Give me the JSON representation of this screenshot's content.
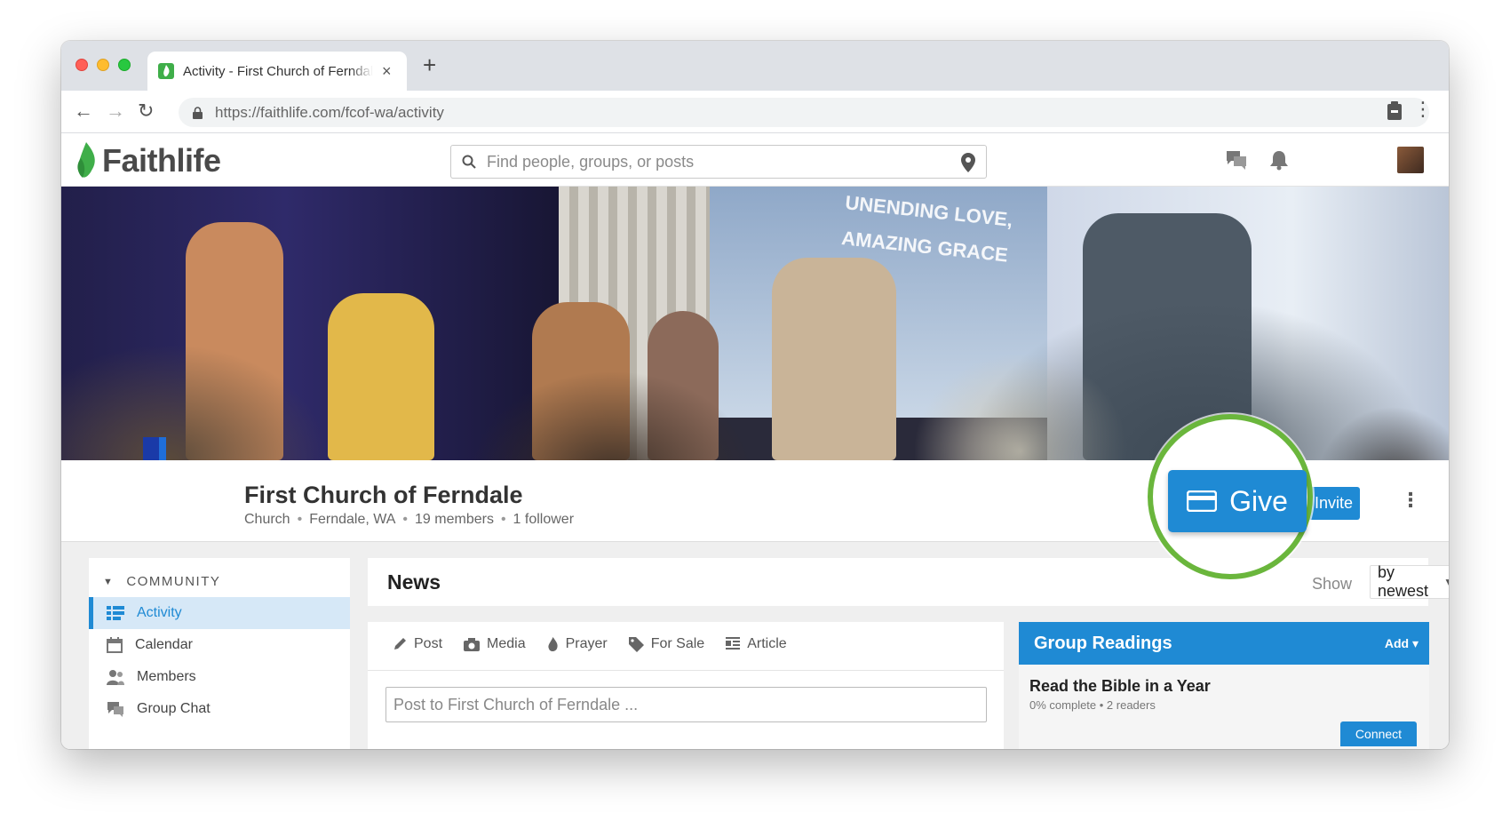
{
  "browser": {
    "tab_title": "Activity - First Church of Ferndale",
    "tab_close": "×",
    "new_tab": "+",
    "url_domain": "https://faithlife.com",
    "url_path": "/fcof-wa/activity"
  },
  "header": {
    "logo_text": "Faithlife",
    "search_placeholder": "Find people, groups, or posts"
  },
  "banner": {
    "screen_text_line1": "UNENDING LOVE,",
    "screen_text_line2": "AMAZING GRACE"
  },
  "group": {
    "name": "First Church of Ferndale",
    "type": "Church",
    "location": "Ferndale, WA",
    "members": "19 members",
    "followers": "1 follower",
    "give_label": "Give",
    "invite_label": "Invite"
  },
  "sidebar": {
    "heading": "COMMUNITY",
    "items": [
      {
        "label": "Activity",
        "icon": "activity-icon"
      },
      {
        "label": "Calendar",
        "icon": "calendar-icon"
      },
      {
        "label": "Members",
        "icon": "members-icon"
      },
      {
        "label": "Group Chat",
        "icon": "chat-icon"
      }
    ]
  },
  "news": {
    "title": "News",
    "show_label": "Show",
    "sort_value": "by newest"
  },
  "composer": {
    "tabs": [
      {
        "label": "Post",
        "icon": "pencil-icon"
      },
      {
        "label": "Media",
        "icon": "camera-icon"
      },
      {
        "label": "Prayer",
        "icon": "flame-icon"
      },
      {
        "label": "For Sale",
        "icon": "tag-icon"
      },
      {
        "label": "Article",
        "icon": "article-icon"
      }
    ],
    "placeholder": "Post to First Church of Ferndale ..."
  },
  "readings": {
    "title": "Group Readings",
    "add_label": "Add ▾",
    "item_title": "Read the Bible in a Year",
    "item_meta": "0% complete • 2 readers",
    "connect_label": "Connect"
  },
  "colors": {
    "brand_blue": "#1f8ad4",
    "faithlife_green": "#3fae49",
    "highlight_green": "#6ab63c"
  }
}
